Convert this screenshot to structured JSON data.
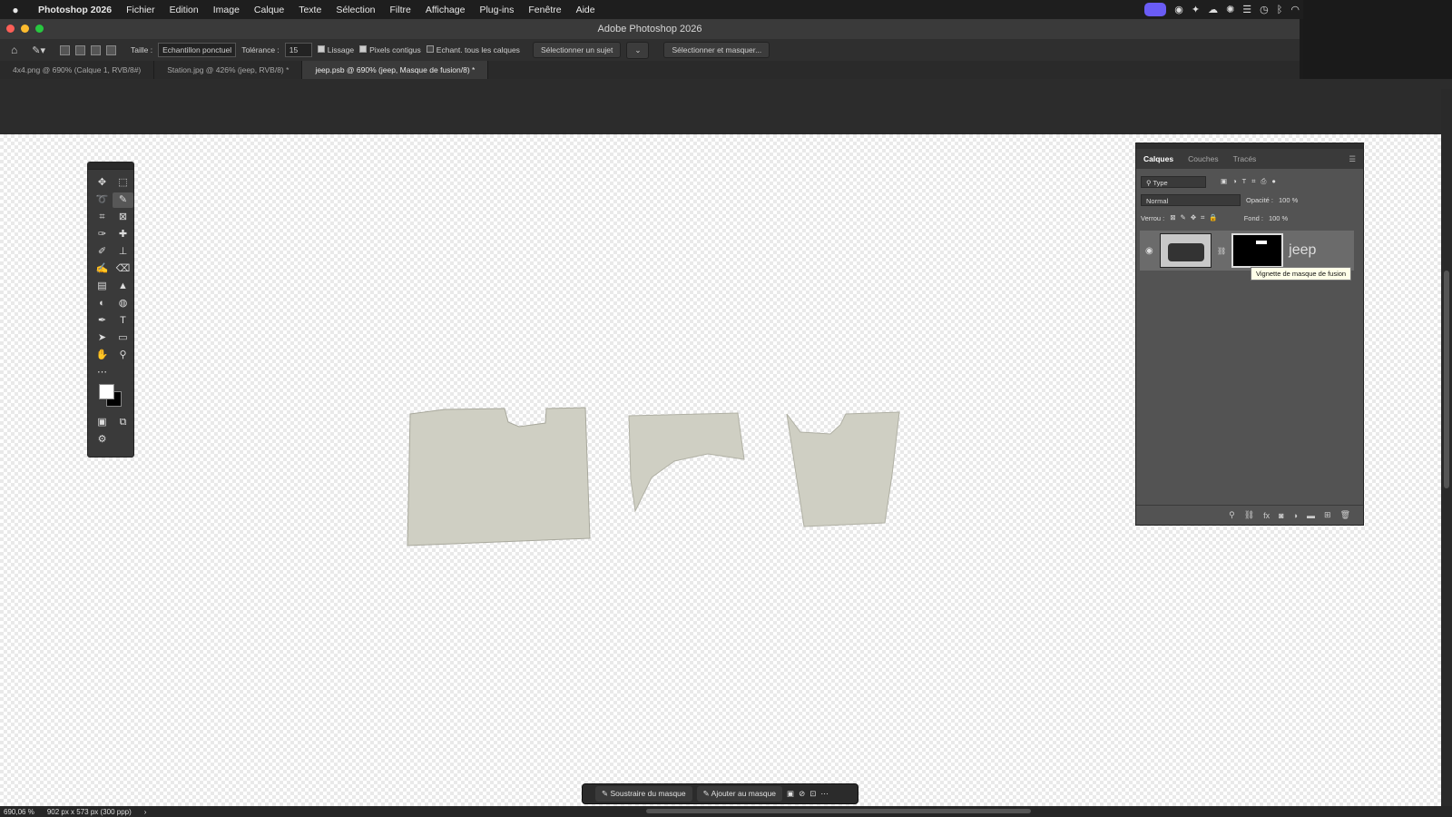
{
  "menubar": {
    "app": "Photoshop 2026",
    "items": [
      "Fichier",
      "Edition",
      "Image",
      "Calque",
      "Texte",
      "Sélection",
      "Filtre",
      "Affichage",
      "Plug-ins",
      "Fenêtre",
      "Aide"
    ]
  },
  "window": {
    "title": "Adobe Photoshop 2026"
  },
  "options": {
    "taille_label": "Taille :",
    "taille_value": "Echantillon ponctuel",
    "tolerance_label": "Tolérance :",
    "tolerance_value": "15",
    "lissage": "Lissage",
    "pixels": "Pixels contigus",
    "echant": "Echant. tous les calques",
    "select_subject": "Sélectionner un sujet",
    "select_mask": "Sélectionner et masquer..."
  },
  "tabs": [
    "4x4.png @ 690% (Calque 1, RVB/8#)",
    "Station.jpg @ 426% (jeep, RVB/8) *",
    "jeep.psb @ 690% (jeep, Masque de fusion/8) *"
  ],
  "layers": {
    "tabs": [
      "Calques",
      "Couches",
      "Tracés"
    ],
    "filter": "Type",
    "blend": "Normal",
    "opacity_label": "Opacité :",
    "opacity": "100 %",
    "lock_label": "Verrou :",
    "fill_label": "Fond :",
    "fill": "100 %",
    "layer_name": "jeep",
    "tooltip": "Vignette de masque de fusion"
  },
  "ctx": {
    "subtract": "Soustraire du masque",
    "add": "Ajouter au masque"
  },
  "status": {
    "zoom": "690,06 %",
    "doc": "902 px x 573 px (300 ppp)"
  }
}
